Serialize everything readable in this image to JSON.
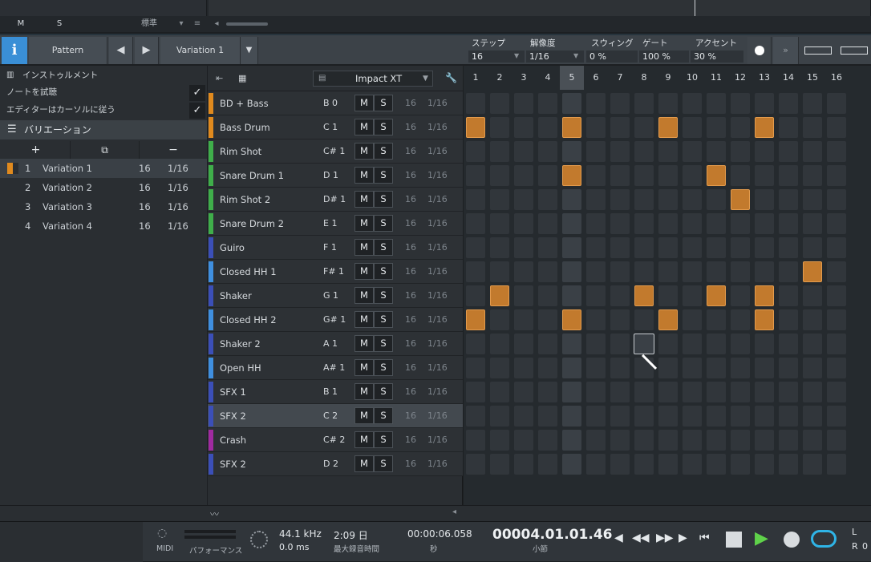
{
  "topstrip": {
    "m_label": "M",
    "s_label": "S",
    "mode_label": "標準"
  },
  "header": {
    "info_label": "i",
    "pattern_label": "Pattern",
    "variation_label": "Variation 1",
    "step_label": "ステップ",
    "step_value": "16",
    "resolution_label": "解像度",
    "resolution_value": "1/16",
    "swing_label": "スウィング",
    "swing_value": "0 %",
    "gate_label": "ゲート",
    "gate_value": "100 %",
    "accent_label": "アクセント",
    "accent_value": "30 %"
  },
  "left": {
    "instrument_label": "インストゥルメント",
    "audition_label": "ノートを試聴",
    "follow_label": "エディターはカーソルに従う",
    "variations_title": "バリエーション",
    "add_label": "+",
    "duplicate_label": "⧉",
    "remove_label": "−",
    "variations": [
      {
        "num": "1",
        "name": "Variation 1",
        "steps": "16",
        "res": "1/16"
      },
      {
        "num": "2",
        "name": "Variation 2",
        "steps": "16",
        "res": "1/16"
      },
      {
        "num": "3",
        "name": "Variation 3",
        "steps": "16",
        "res": "1/16"
      },
      {
        "num": "4",
        "name": "Variation 4",
        "steps": "16",
        "res": "1/16"
      }
    ]
  },
  "instruments_header": {
    "device": "Impact XT"
  },
  "instruments": [
    {
      "name": "BD + Bass",
      "note": "B 0",
      "color": "#e08a1e"
    },
    {
      "name": "Bass Drum",
      "note": "C 1",
      "color": "#e08a1e"
    },
    {
      "name": "Rim Shot",
      "note": "C# 1",
      "color": "#3fae4a"
    },
    {
      "name": "Snare Drum 1",
      "note": "D 1",
      "color": "#3fae4a"
    },
    {
      "name": "Rim Shot 2",
      "note": "D# 1",
      "color": "#3fae4a"
    },
    {
      "name": "Snare Drum 2",
      "note": "E 1",
      "color": "#3fae4a"
    },
    {
      "name": "Guiro",
      "note": "F 1",
      "color": "#3b4fb8"
    },
    {
      "name": "Closed HH 1",
      "note": "F# 1",
      "color": "#3f8fe0"
    },
    {
      "name": "Shaker",
      "note": "G 1",
      "color": "#3b4fb8"
    },
    {
      "name": "Closed HH 2",
      "note": "G# 1",
      "color": "#3f8fe0"
    },
    {
      "name": "Shaker 2",
      "note": "A 1",
      "color": "#3b4fb8"
    },
    {
      "name": "Open HH",
      "note": "A# 1",
      "color": "#3f8fe0"
    },
    {
      "name": "SFX 1",
      "note": "B 1",
      "color": "#3b4fb8"
    },
    {
      "name": "SFX 2",
      "note": "C 2",
      "color": "#3b4fb8"
    },
    {
      "name": "Crash",
      "note": "C# 2",
      "color": "#a02aa0"
    },
    {
      "name": "SFX 2",
      "note": "D 2",
      "color": "#3b4fb8"
    }
  ],
  "inst_common": {
    "m": "M",
    "s": "S",
    "steps": "16",
    "res": "1/16"
  },
  "step_numbers": [
    "1",
    "2",
    "3",
    "4",
    "5",
    "6",
    "7",
    "8",
    "9",
    "10",
    "11",
    "12",
    "13",
    "14",
    "15",
    "16"
  ],
  "active_steps": [
    [],
    [
      1,
      5,
      9,
      13
    ],
    [],
    [
      5,
      11
    ],
    [
      12
    ],
    [],
    [],
    [
      15
    ],
    [
      2,
      8,
      11,
      13
    ],
    [
      1,
      5,
      9,
      13
    ],
    [],
    [],
    [],
    [],
    [],
    []
  ],
  "transport": {
    "midi_label": "MIDI",
    "perf_label": "パフォーマンス",
    "sample_rate": "44.1 kHz",
    "latency": "0.0 ms",
    "rec_time": "2:09 日",
    "rec_time_label": "最大録音時間",
    "seconds": "00:00:06.058",
    "seconds_label": "秒",
    "bars": "00004.01.01.46",
    "bars_label": "小節",
    "l_label": "L",
    "r_label": "R",
    "r_value": "0"
  }
}
